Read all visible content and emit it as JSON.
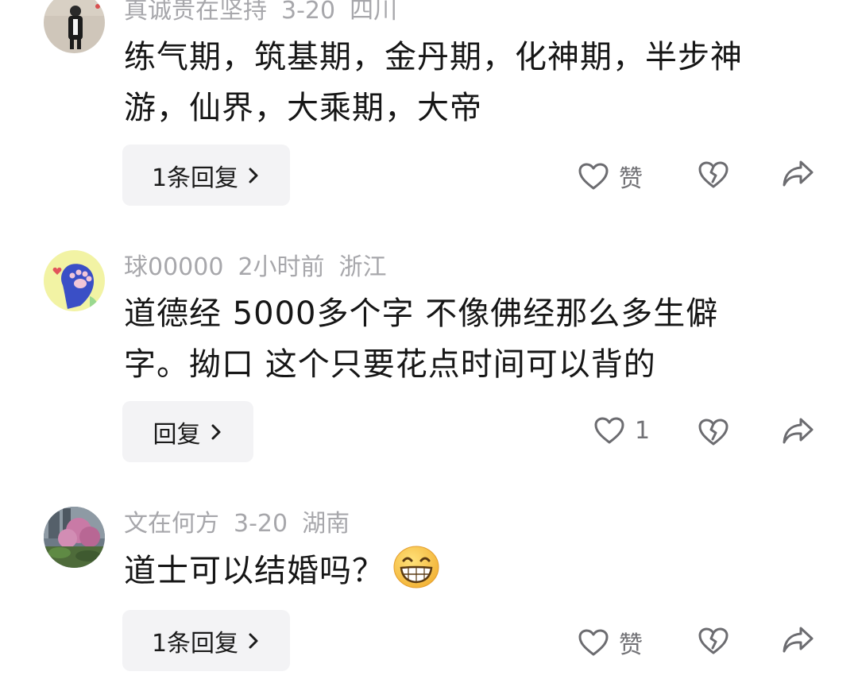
{
  "colors": {
    "meta_text": "#a7a7ab",
    "body_text": "#161616",
    "reply_button_bg": "#f3f3f5",
    "icon_stroke": "#6c6c70"
  },
  "comments": [
    {
      "username": "真诚贵在坚持",
      "time": "3-20",
      "location": "四川",
      "text_line1": "练气期，筑基期，金丹期，化神期，半步神",
      "text_line2": "游，仙界，大乘期，大帝",
      "reply_label": "1条回复",
      "like_label": "赞",
      "icons": [
        "heart-outline-icon",
        "dislike-broken-heart-icon",
        "share-arrow-icon",
        "chevron-right-icon"
      ]
    },
    {
      "username": "球00000",
      "time": "2小时前",
      "location": "浙江",
      "text_line1": "道德经 5000多个字 不像佛经那么多生僻",
      "text_line2": "字。拗口 这个只要花点时间可以背的",
      "reply_label": "回复",
      "like_label": "1",
      "icons": [
        "heart-outline-icon",
        "dislike-broken-heart-icon",
        "share-arrow-icon",
        "chevron-right-icon"
      ]
    },
    {
      "username": "文在何方",
      "time": "3-20",
      "location": "湖南",
      "text_line1": "道士可以结婚吗？",
      "emoji": "grinning-emoji",
      "reply_label": "1条回复",
      "like_label": "赞",
      "icons": [
        "heart-outline-icon",
        "dislike-broken-heart-icon",
        "share-arrow-icon",
        "chevron-right-icon"
      ]
    }
  ]
}
